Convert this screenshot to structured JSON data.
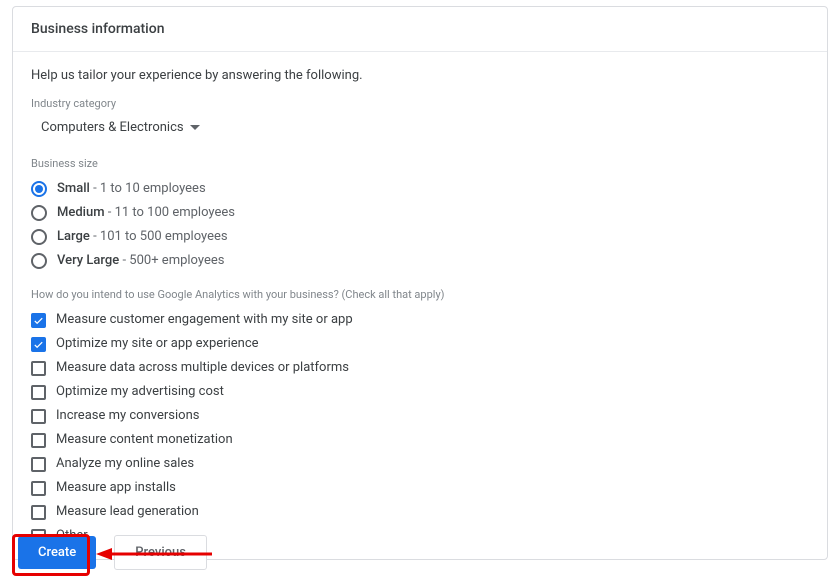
{
  "header": {
    "title": "Business information"
  },
  "helpText": "Help us tailor your experience by answering the following.",
  "industry": {
    "label": "Industry category",
    "selected": "Computers & Electronics"
  },
  "businessSize": {
    "label": "Business size",
    "options": [
      {
        "main": "Small",
        "detail": " - 1 to 10 employees",
        "checked": true
      },
      {
        "main": "Medium",
        "detail": " - 11 to 100 employees",
        "checked": false
      },
      {
        "main": "Large",
        "detail": " - 101 to 500 employees",
        "checked": false
      },
      {
        "main": "Very Large",
        "detail": " - 500+ employees",
        "checked": false
      }
    ]
  },
  "usage": {
    "label": "How do you intend to use Google Analytics with your business? (Check all that apply)",
    "options": [
      {
        "label": "Measure customer engagement with my site or app",
        "checked": true
      },
      {
        "label": "Optimize my site or app experience",
        "checked": true
      },
      {
        "label": "Measure data across multiple devices or platforms",
        "checked": false
      },
      {
        "label": "Optimize my advertising cost",
        "checked": false
      },
      {
        "label": "Increase my conversions",
        "checked": false
      },
      {
        "label": "Measure content monetization",
        "checked": false
      },
      {
        "label": "Analyze my online sales",
        "checked": false
      },
      {
        "label": "Measure app installs",
        "checked": false
      },
      {
        "label": "Measure lead generation",
        "checked": false
      },
      {
        "label": "Other",
        "checked": false
      }
    ]
  },
  "buttons": {
    "create": "Create",
    "previous": "Previous"
  }
}
